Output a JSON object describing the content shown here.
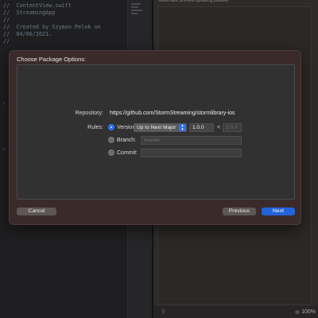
{
  "editor": {
    "code_lines": [
      "//  ContentView.swift",
      "//  StreamingApp",
      "//",
      "//  Created by Szymon Pelok on",
      "//  04/06/2021.",
      "//"
    ],
    "preview_header": "Automatic preview updating paused",
    "zoom": "100%"
  },
  "dialog": {
    "title": "Choose Package Options:",
    "repository_label": "Repository:",
    "repository_url": "https://github.com/StormStreaming/stormlibrary-ios",
    "rules_label": "Rules:",
    "options": [
      {
        "label": "Version:",
        "selected": true
      },
      {
        "label": "Branch:",
        "selected": false
      },
      {
        "label": "Commit:",
        "selected": false
      }
    ],
    "version_rule": "Up to Next Major",
    "version_from": "1.0.0",
    "version_separator": "<",
    "version_to_placeholder": "2.0.0",
    "branch_placeholder": "master",
    "commit_value": "",
    "buttons": {
      "cancel": "Cancel",
      "previous": "Previous",
      "next": "Next"
    }
  },
  "colors": {
    "accent": "#2362d9",
    "sheet_bg": "#3a2b2a",
    "panel_bg": "#313131"
  }
}
